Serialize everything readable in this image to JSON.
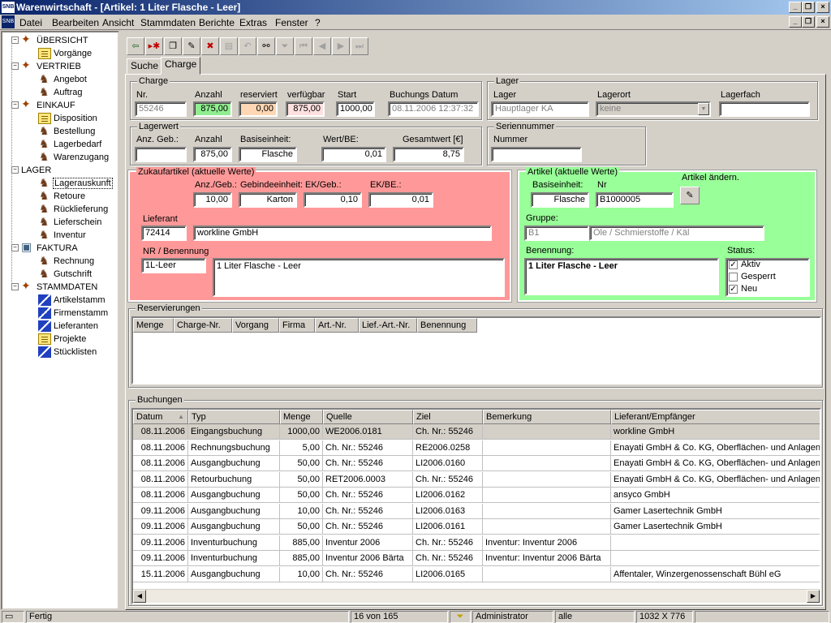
{
  "window": {
    "app_tag": "SNB",
    "title": "Warenwirtschaft - [Artikel: 1 Liter Flasche - Leer]"
  },
  "menu": [
    "Datei",
    "Bearbeiten",
    "Ansicht",
    "Stammdaten",
    "Berichte",
    "Extras",
    "Fenster",
    "?"
  ],
  "sidebar": {
    "groups": [
      {
        "label": "ÜBERSICHT",
        "icon": "overview-icon",
        "items": [
          {
            "label": "Vorgänge",
            "icon": "document-icon"
          }
        ]
      },
      {
        "label": "VERTRIEB",
        "icon": "sales-icon",
        "items": [
          {
            "label": "Angebot",
            "icon": "offer-icon"
          },
          {
            "label": "Auftrag",
            "icon": "order-icon"
          }
        ]
      },
      {
        "label": "EINKAUF",
        "icon": "purchase-icon",
        "items": [
          {
            "label": "Disposition",
            "icon": "document-icon"
          },
          {
            "label": "Bestellung",
            "icon": "horse-icon"
          },
          {
            "label": "Lagerbedarf",
            "icon": "horse-icon"
          },
          {
            "label": "Warenzugang",
            "icon": "horse-icon"
          }
        ]
      },
      {
        "label": "LAGER",
        "icon": "warehouse-icon",
        "items": [
          {
            "label": "Lagerauskunft",
            "icon": "horse-icon",
            "selected": true
          },
          {
            "label": "Retoure",
            "icon": "horse-icon"
          },
          {
            "label": "Rücklieferung",
            "icon": "horse-icon"
          },
          {
            "label": "Lieferschein",
            "icon": "horse-icon"
          },
          {
            "label": "Inventur",
            "icon": "horse-icon"
          }
        ]
      },
      {
        "label": "FAKTURA",
        "icon": "billing-icon",
        "items": [
          {
            "label": "Rechnung",
            "icon": "invoice-icon"
          },
          {
            "label": "Gutschrift",
            "icon": "credit-icon"
          }
        ]
      },
      {
        "label": "STAMMDATEN",
        "icon": "masterdata-icon",
        "items": [
          {
            "label": "Artikelstamm",
            "icon": "ruler-icon"
          },
          {
            "label": "Firmenstamm",
            "icon": "ruler-icon"
          },
          {
            "label": "Lieferanten",
            "icon": "ruler-icon"
          },
          {
            "label": "Projekte",
            "icon": "document-icon"
          },
          {
            "label": "Stücklisten",
            "icon": "ruler-icon"
          }
        ]
      }
    ]
  },
  "toolbar": {
    "buttons": [
      {
        "name": "exit-button",
        "glyph": "⇦"
      },
      {
        "name": "new-button",
        "glyph": "▸✱"
      },
      {
        "name": "copy-button",
        "glyph": "❐"
      },
      {
        "name": "edit-button",
        "glyph": "✎"
      },
      {
        "name": "delete-button",
        "glyph": "✖"
      },
      {
        "name": "save-button",
        "glyph": "▤"
      },
      {
        "name": "undo-button",
        "glyph": "↶"
      },
      {
        "name": "find-button",
        "glyph": "⚯"
      },
      {
        "name": "filter-button",
        "glyph": "⏷"
      },
      {
        "name": "first-record-button",
        "glyph": "⏮"
      },
      {
        "name": "prev-record-button",
        "glyph": "◀"
      },
      {
        "name": "next-record-button",
        "glyph": "▶"
      },
      {
        "name": "last-record-button",
        "glyph": "⏭"
      }
    ]
  },
  "tabs": [
    "Suche",
    "Charge"
  ],
  "charge": {
    "title": "Charge",
    "labels": {
      "nr": "Nr.",
      "anzahl": "Anzahl",
      "reserviert": "reserviert",
      "verfuegbar": "verfügbar",
      "start": "Start",
      "buchungsdatum": "Buchungs Datum"
    },
    "values": {
      "nr": "55246",
      "anzahl": "875,00",
      "reserviert": "0,00",
      "verfuegbar": "875,00",
      "start": "1000,00",
      "buchungsdatum": "08.11.2006 12:37:32"
    }
  },
  "lager": {
    "title": "Lager",
    "labels": {
      "lager": "Lager",
      "lagerort": "Lagerort",
      "lagerfach": "Lagerfach"
    },
    "values": {
      "lager": "Hauptlager KA",
      "lagerort": "keine",
      "lagerfach": ""
    }
  },
  "lagerwert": {
    "title": "Lagerwert",
    "labels": {
      "anz_geb": "Anz. Geb.:",
      "anzahl": "Anzahl",
      "basiseinheit": "Basiseinheit:",
      "wert_be": "Wert/BE:",
      "gesamtwert": "Gesamtwert [€]"
    },
    "values": {
      "anz_geb": "",
      "anzahl": "875,00",
      "basiseinheit": "Flasche",
      "wert_be": "0,01",
      "gesamtwert": "8,75"
    }
  },
  "seriennummer": {
    "title": "Seriennummer",
    "labels": {
      "nummer": "Nummer"
    },
    "values": {
      "nummer": ""
    }
  },
  "zukauf": {
    "title": "Zukaufartikel (aktuelle Werte)",
    "labels": {
      "anz_geb": "Anz./Geb.:",
      "gebindeeinheit": "Gebindeeinheit:",
      "ek_geb": "EK/Geb.:",
      "ek_be": "EK/BE.:",
      "lieferant": "Lieferant",
      "nr_benennung": "NR / Benennung"
    },
    "values": {
      "anz_geb": "10,00",
      "gebindeeinheit": "Karton",
      "ek_geb": "0,10",
      "ek_be": "0,01",
      "lieferant_nr": "72414",
      "lieferant_name": "workline GmbH",
      "nr": "1L-Leer",
      "benennung": "1 Liter Flasche - Leer"
    }
  },
  "artikel": {
    "title": "Artikel (aktuelle Werte)",
    "labels": {
      "basiseinheit": "Basiseinheit:",
      "nr": "Nr",
      "aendern": "Artikel ändern.",
      "gruppe": "Gruppe:",
      "benennung": "Benennung:",
      "status": "Status:"
    },
    "values": {
      "basiseinheit": "Flasche",
      "nr": "B1000005",
      "gruppe_code": "B1",
      "gruppe_name": "Öle / Schmierstoffe / Käl",
      "benennung": "1 Liter Flasche - Leer"
    },
    "status": [
      {
        "label": "Aktiv",
        "checked": true
      },
      {
        "label": "Gesperrt",
        "checked": false
      },
      {
        "label": "Neu",
        "checked": true
      }
    ]
  },
  "reservierungen": {
    "title": "Reservierungen",
    "columns": [
      "Menge",
      "Charge-Nr.",
      "Vorgang",
      "Firma",
      "Art.-Nr.",
      "Lief.-Art.-Nr.",
      "Benennung"
    ]
  },
  "buchungen": {
    "title": "Buchungen",
    "sort_glyph": "▲",
    "columns": [
      "Datum",
      "Typ",
      "Menge",
      "Quelle",
      "Ziel",
      "Bemerkung",
      "Lieferant/Empfänger"
    ],
    "rows": [
      [
        "08.11.2006",
        "Eingangsbuchung",
        "1000,00",
        "WE2006.0181",
        "Ch. Nr.: 55246",
        "",
        "workline GmbH"
      ],
      [
        "08.11.2006",
        "Rechnungsbuchung",
        "5,00",
        "Ch. Nr.: 55246",
        "RE2006.0258",
        "",
        "Enayati  GmbH & Co. KG, Oberflächen- und Anlagen"
      ],
      [
        "08.11.2006",
        "Ausgangbuchung",
        "50,00",
        "Ch. Nr.: 55246",
        "LI2006.0160",
        "",
        "Enayati  GmbH & Co. KG, Oberflächen- und Anlagen"
      ],
      [
        "08.11.2006",
        "Retourbuchung",
        "50,00",
        "RET2006.0003",
        "Ch. Nr.: 55246",
        "",
        "Enayati  GmbH & Co. KG, Oberflächen- und Anlagen"
      ],
      [
        "08.11.2006",
        "Ausgangbuchung",
        "50,00",
        "Ch. Nr.: 55246",
        "LI2006.0162",
        "",
        "ansyco GmbH"
      ],
      [
        "09.11.2006",
        "Ausgangbuchung",
        "10,00",
        "Ch. Nr.: 55246",
        "LI2006.0163",
        "",
        "Gamer Lasertechnik GmbH"
      ],
      [
        "09.11.2006",
        "Ausgangbuchung",
        "50,00",
        "Ch. Nr.: 55246",
        "LI2006.0161",
        "",
        "Gamer Lasertechnik GmbH"
      ],
      [
        "09.11.2006",
        "Inventurbuchung",
        "885,00",
        "Inventur 2006",
        "Ch. Nr.: 55246",
        "Inventur: Inventur 2006",
        ""
      ],
      [
        "09.11.2006",
        "Inventurbuchung",
        "885,00",
        "Inventur 2006 Bärta",
        "Ch. Nr.: 55246",
        "Inventur: Inventur 2006 Bärta",
        ""
      ],
      [
        "15.11.2006",
        "Ausgangbuchung",
        "10,00",
        "Ch. Nr.: 55246",
        "LI2006.0165",
        "",
        "Affentaler, Winzergenossenschaft Bühl eG"
      ]
    ]
  },
  "statusbar": {
    "status": "Fertig",
    "record": "16 von 165",
    "user": "Administrator",
    "filter": "alle",
    "resolution": "1032 X 776"
  },
  "colors": {
    "titlebar_start": "#0a246a",
    "red_panel": "#ff9999",
    "green_panel": "#99ff99",
    "anzahl_field": "#90ee90",
    "reserviert_field": "#ffd7b4",
    "verfuegbar_field": "#ffe0e0"
  }
}
